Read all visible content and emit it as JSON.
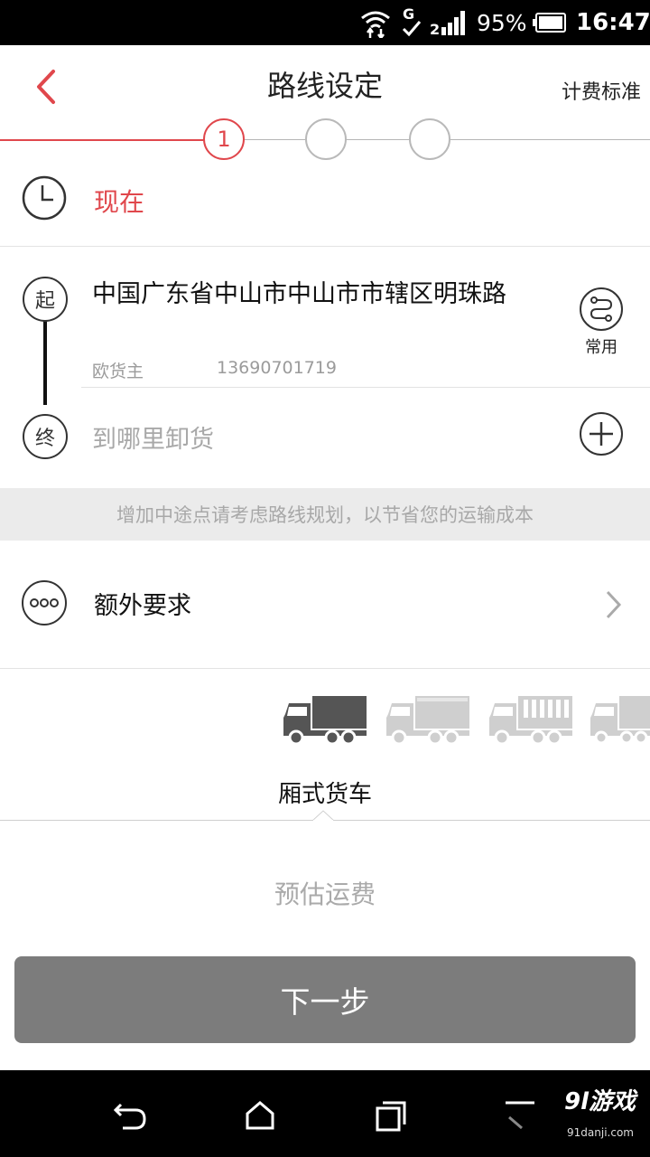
{
  "status_bar": {
    "battery_percent": "95%",
    "time": "16:47",
    "network_type": "G",
    "signal_indicator": "2",
    "icons": [
      "wifi-data-icon",
      "network-g-icon",
      "signal-icon",
      "battery-icon"
    ]
  },
  "header": {
    "title": "路线设定",
    "right_link": "计费标准",
    "back_icon": "chevron-left-icon"
  },
  "stepper": {
    "steps": [
      "1",
      "",
      ""
    ],
    "active_index": 0
  },
  "time": {
    "value": "现在",
    "icon": "clock-icon"
  },
  "route": {
    "start_badge": "起",
    "end_badge": "终",
    "origin_address": "中国广东省中山市中山市市辖区明珠路",
    "contact_name": "欧货主",
    "contact_phone": "13690701719",
    "common_label": "常用",
    "destination_placeholder": "到哪里卸货"
  },
  "hint": "增加中途点请考虑路线规划，以节省您的运输成本",
  "extra": {
    "label": "额外要求",
    "icon": "more-dots-icon"
  },
  "vehicles": {
    "selected_name": "厢式货车",
    "selected_index": 0,
    "icons": [
      "box-truck-icon",
      "van-truck-icon",
      "cage-truck-icon",
      "flatbed-truck-icon"
    ]
  },
  "estimate_label": "预估运费",
  "next_button": "下一步",
  "nav": {
    "icons": [
      "back-nav-icon",
      "home-nav-icon",
      "recents-nav-icon",
      "menu-nav-icon"
    ]
  },
  "watermark": {
    "brand": "9l游戏",
    "site": "91danji.com"
  },
  "colors": {
    "accent": "#e0474c",
    "button": "#7c7c7c",
    "hint_bg": "#ebebeb"
  }
}
